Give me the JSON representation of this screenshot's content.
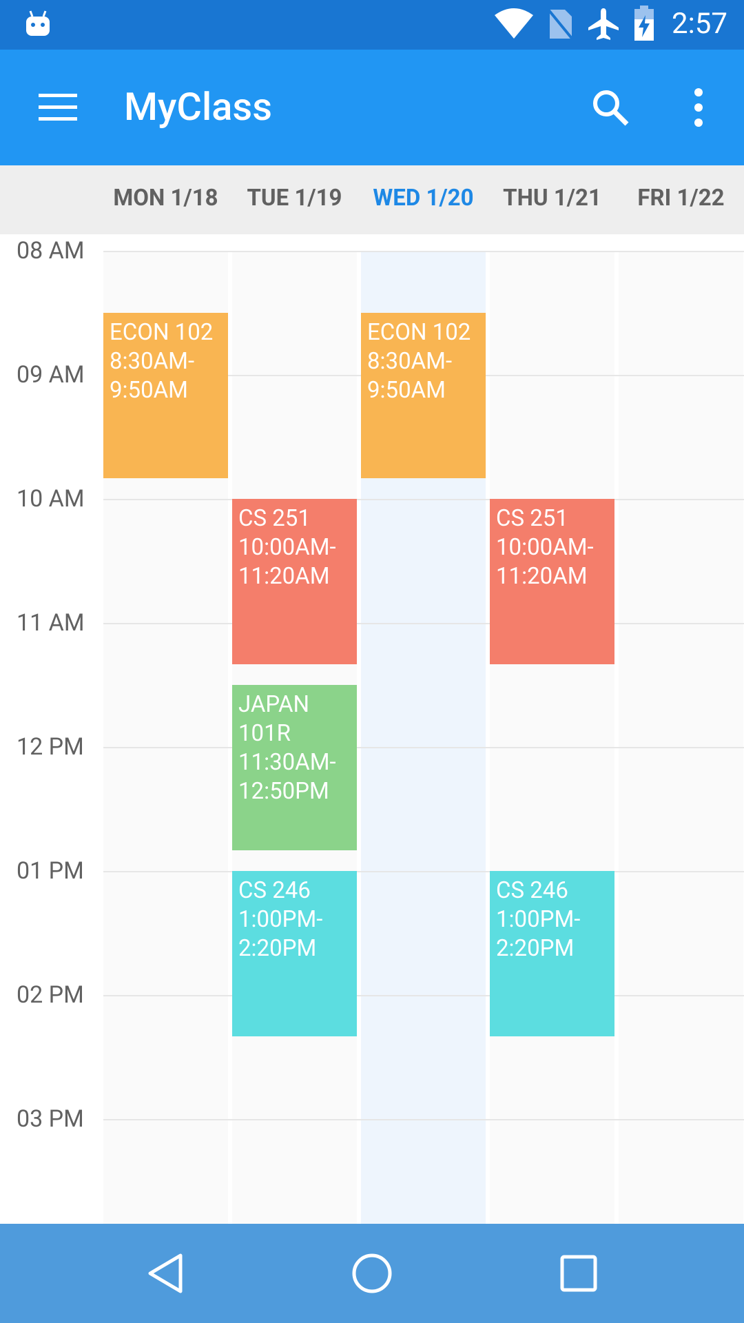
{
  "status_bar": {
    "time": "2:57",
    "icons": [
      "android-debug-icon",
      "wifi-icon",
      "no-sim-icon",
      "airplane-icon",
      "battery-charging-icon"
    ]
  },
  "app_bar": {
    "title": "MyClass",
    "menu_icon": "hamburger-menu-icon",
    "search_icon": "search-icon",
    "overflow_icon": "more-vert-icon"
  },
  "days": [
    {
      "label": "MON 1/18",
      "today": false
    },
    {
      "label": "TUE 1/19",
      "today": false
    },
    {
      "label": "WED 1/20",
      "today": true
    },
    {
      "label": "THU 1/21",
      "today": false
    },
    {
      "label": "FRI 1/22",
      "today": false
    }
  ],
  "hours": [
    "08 AM",
    "09 AM",
    "10 AM",
    "11 AM",
    "12 PM",
    "01 PM",
    "02 PM",
    "03 PM"
  ],
  "events": [
    {
      "day": 0,
      "start": 8.5,
      "end": 9.8333,
      "lines": [
        "ECON 102",
        "8:30AM-",
        "9:50AM"
      ],
      "color": "#F9B552"
    },
    {
      "day": 2,
      "start": 8.5,
      "end": 9.8333,
      "lines": [
        "ECON 102",
        "8:30AM-",
        "9:50AM"
      ],
      "color": "#F9B552"
    },
    {
      "day": 1,
      "start": 10.0,
      "end": 11.3333,
      "lines": [
        "CS 251",
        "10:00AM-",
        "11:20AM"
      ],
      "color": "#F47E6B"
    },
    {
      "day": 3,
      "start": 10.0,
      "end": 11.3333,
      "lines": [
        "CS 251",
        "10:00AM-",
        "11:20AM"
      ],
      "color": "#F47E6B"
    },
    {
      "day": 1,
      "start": 11.5,
      "end": 12.8333,
      "lines": [
        "JAPAN",
        "101R",
        "11:30AM-",
        "12:50PM"
      ],
      "color": "#8BD38A"
    },
    {
      "day": 1,
      "start": 13.0,
      "end": 14.3333,
      "lines": [
        "CS 246",
        "1:00PM-",
        "2:20PM"
      ],
      "color": "#5CDDE0"
    },
    {
      "day": 3,
      "start": 13.0,
      "end": 14.3333,
      "lines": [
        "CS 246",
        "1:00PM-",
        "2:20PM"
      ],
      "color": "#5CDDE0"
    }
  ],
  "nav_bar": {
    "back_icon": "back-triangle-icon",
    "home_icon": "home-circle-icon",
    "recents_icon": "recents-square-icon"
  },
  "colors": {
    "status_bar": "#1976D2",
    "app_bar": "#2196F3",
    "today_accent": "#1E88E5",
    "nav_bar": "#4F9BDC"
  }
}
